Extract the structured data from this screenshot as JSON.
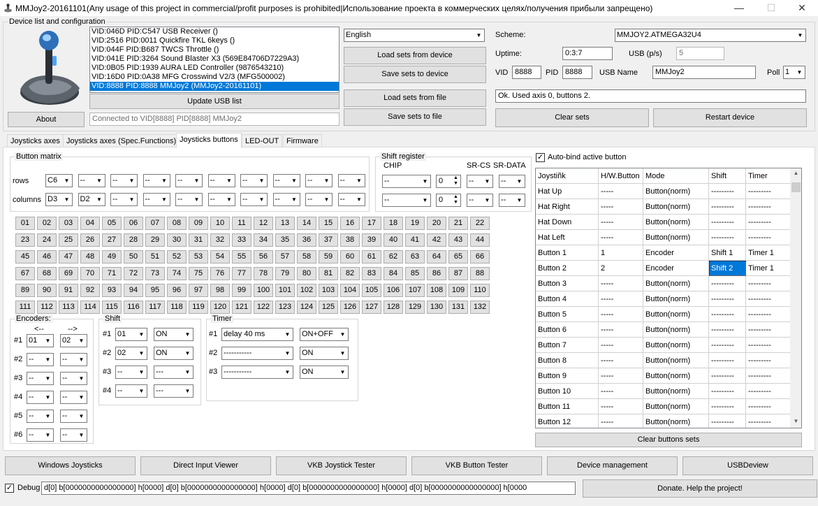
{
  "window": {
    "title": "MMJoy2-20161101(Any usage of this project in commercial/profit purposes is prohibited|Использование проекта в коммерческих целях/получения прибыли запрещено)",
    "minimize": "—",
    "maximize": "☐",
    "close": "✕"
  },
  "device": {
    "group_label": "Device list and configuration",
    "about": "About",
    "devices": [
      "VID:046D PID:C547 USB Receiver ()",
      "VID:2516 PID:0011 Quickfire TKL 6keys ()",
      "VID:044F PID:B687 TWCS Throttle ()",
      "VID:041E PID:3264 Sound Blaster X3 (569E84706D7229A3)",
      "VID:0B05 PID:1939 AURA LED Controller (9876543210)",
      "VID:16D0 PID:0A38 MFG Crosswind V2/3 (MFG500002)",
      "VID:8888 PID:8888 MMJoy2 (MMJoy2-20161101)"
    ],
    "selected_index": 6,
    "update_usb": "Update USB list",
    "connected": "Connected to VID[8888] PID[8888] MMJoy2",
    "language": "English",
    "load_device": "Load sets from device",
    "save_device": "Save sets to device",
    "load_file": "Load sets from file",
    "save_file": "Save sets to file",
    "scheme_label": "Scheme:",
    "scheme": "MMJOY2.ATMEGA32U4",
    "uptime_label": "Uptime:",
    "uptime": "0:3:7",
    "usb_ps_label": "USB (p/s)",
    "usb_ps": "5",
    "vid_label": "VID",
    "vid": "8888",
    "pid_label": "PID",
    "pid": "8888",
    "usbname_label": "USB Name",
    "usbname": "MMJoy2",
    "poll_label": "Poll",
    "poll": "1",
    "status": "Ok. Used axis  0, buttons 2.",
    "clear_sets": "Clear sets",
    "restart": "Restart device"
  },
  "tabs": [
    "Joysticks axes",
    "Joysticks axes (Spec.Functions)",
    "Joysticks buttons",
    "LED-OUT",
    "Firmware"
  ],
  "matrix": {
    "label": "Button matrix",
    "rows_label": "rows",
    "cols_label": "columns",
    "rows": [
      "C6",
      "--",
      "--",
      "--",
      "--",
      "--",
      "--",
      "--",
      "--",
      "--"
    ],
    "cols": [
      "D3",
      "D2",
      "--",
      "--",
      "--",
      "--",
      "--",
      "--",
      "--",
      "--"
    ]
  },
  "shiftreg": {
    "label": "Shift register",
    "chip_label": "CHIP",
    "srcs_label": "SR-CS",
    "srdata_label": "SR-DATA",
    "rows": [
      {
        "chip": "--",
        "num": "0",
        "cs": "--",
        "data": "--"
      },
      {
        "chip": "--",
        "num": "0",
        "cs": "--",
        "data": "--"
      }
    ]
  },
  "buttons": [
    "01",
    "02",
    "03",
    "04",
    "05",
    "06",
    "07",
    "08",
    "09",
    "10",
    "11",
    "12",
    "13",
    "14",
    "15",
    "16",
    "17",
    "18",
    "19",
    "20",
    "21",
    "22",
    "23",
    "24",
    "25",
    "26",
    "27",
    "28",
    "29",
    "30",
    "31",
    "32",
    "33",
    "34",
    "35",
    "36",
    "37",
    "38",
    "39",
    "40",
    "41",
    "42",
    "43",
    "44",
    "45",
    "46",
    "47",
    "48",
    "49",
    "50",
    "51",
    "52",
    "53",
    "54",
    "55",
    "56",
    "57",
    "58",
    "59",
    "60",
    "61",
    "62",
    "63",
    "64",
    "65",
    "66",
    "67",
    "68",
    "69",
    "70",
    "71",
    "72",
    "73",
    "74",
    "75",
    "76",
    "77",
    "78",
    "79",
    "80",
    "81",
    "82",
    "83",
    "84",
    "85",
    "86",
    "87",
    "88",
    "89",
    "90",
    "91",
    "92",
    "93",
    "94",
    "95",
    "96",
    "97",
    "98",
    "99",
    "100",
    "101",
    "102",
    "103",
    "104",
    "105",
    "106",
    "107",
    "108",
    "109",
    "110",
    "111",
    "112",
    "113",
    "114",
    "115",
    "116",
    "117",
    "118",
    "119",
    "120",
    "121",
    "122",
    "123",
    "124",
    "125",
    "126",
    "127",
    "128",
    "129",
    "130",
    "131",
    "132"
  ],
  "encoders": {
    "label": "Encoders:",
    "left_arrow": "<--",
    "right_arrow": "-->",
    "rows": [
      {
        "n": "#1",
        "a": "01",
        "b": "02"
      },
      {
        "n": "#2",
        "a": "--",
        "b": "--"
      },
      {
        "n": "#3",
        "a": "--",
        "b": "--"
      },
      {
        "n": "#4",
        "a": "--",
        "b": "--"
      },
      {
        "n": "#5",
        "a": "--",
        "b": "--"
      },
      {
        "n": "#6",
        "a": "--",
        "b": "--"
      }
    ]
  },
  "shift": {
    "label": "Shift",
    "rows": [
      {
        "n": "#1",
        "a": "01",
        "b": "ON"
      },
      {
        "n": "#2",
        "a": "02",
        "b": "ON"
      },
      {
        "n": "#3",
        "a": "--",
        "b": "---"
      },
      {
        "n": "#4",
        "a": "--",
        "b": "---"
      }
    ]
  },
  "timer": {
    "label": "Timer",
    "rows": [
      {
        "n": "#1",
        "a": "delay 40 ms",
        "b": "ON+OFF"
      },
      {
        "n": "#2",
        "a": "-----------",
        "b": "ON"
      },
      {
        "n": "#3",
        "a": "-----------",
        "b": "ON"
      }
    ]
  },
  "autobind": {
    "label": "Auto-bind active button",
    "checked": "✓"
  },
  "grid": {
    "headers": [
      "Joystiñk",
      "H/W.Button",
      "Mode",
      "Shift",
      "Timer"
    ],
    "rows": [
      [
        "Hat Up",
        "-----",
        "Button(norm)",
        "---------",
        "---------"
      ],
      [
        "Hat Right",
        "-----",
        "Button(norm)",
        "---------",
        "---------"
      ],
      [
        "Hat Down",
        "-----",
        "Button(norm)",
        "---------",
        "---------"
      ],
      [
        "Hat Left",
        "-----",
        "Button(norm)",
        "---------",
        "---------"
      ],
      [
        "Button 1",
        "1",
        "Encoder",
        "Shift 1",
        "Timer 1"
      ],
      [
        "Button 2",
        "2",
        "Encoder",
        "Shift 2",
        "Timer 1"
      ],
      [
        "Button 3",
        "-----",
        "Button(norm)",
        "---------",
        "---------"
      ],
      [
        "Button 4",
        "-----",
        "Button(norm)",
        "---------",
        "---------"
      ],
      [
        "Button 5",
        "-----",
        "Button(norm)",
        "---------",
        "---------"
      ],
      [
        "Button 6",
        "-----",
        "Button(norm)",
        "---------",
        "---------"
      ],
      [
        "Button 7",
        "-----",
        "Button(norm)",
        "---------",
        "---------"
      ],
      [
        "Button 8",
        "-----",
        "Button(norm)",
        "---------",
        "---------"
      ],
      [
        "Button 9",
        "-----",
        "Button(norm)",
        "---------",
        "---------"
      ],
      [
        "Button 10",
        "-----",
        "Button(norm)",
        "---------",
        "---------"
      ],
      [
        "Button 11",
        "-----",
        "Button(norm)",
        "---------",
        "---------"
      ],
      [
        "Button 12",
        "-----",
        "Button(norm)",
        "---------",
        "---------"
      ]
    ],
    "selected_row": 5,
    "selected_col": 3
  },
  "clear_buttons": "Clear buttons sets",
  "bottom": [
    "Windows Joysticks",
    "Direct Input Viewer",
    "VKB Joystick Tester",
    "VKB Button Tester",
    "Device management",
    "USBDeview"
  ],
  "debug": {
    "label": "Debug",
    "checked": "✓",
    "text": "d[0] b[0000000000000000] h[0000]   d[0] b[0000000000000000] h[0000]   d[0] b[0000000000000000] h[0000]   d[0] b[0000000000000000] h[0000"
  },
  "donate": "Donate. Help the project!"
}
